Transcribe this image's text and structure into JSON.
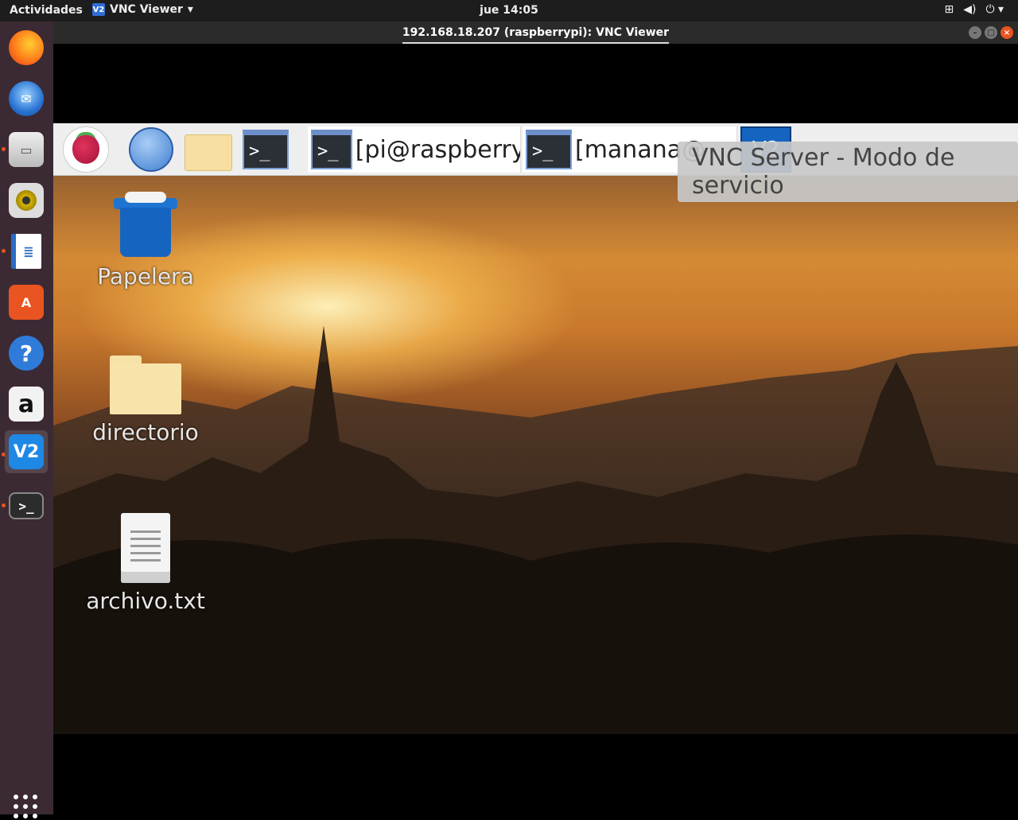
{
  "topbar": {
    "activities": "Actividades",
    "app_menu_label": "VNC Viewer",
    "clock": "jue 14:05",
    "icons": [
      "network-icon",
      "volume-icon",
      "power-icon",
      "chevron-down-icon"
    ]
  },
  "dock": {
    "items": [
      {
        "name": "Firefox",
        "icon": "firefox-icon"
      },
      {
        "name": "Thunderbird",
        "icon": "thunderbird-icon"
      },
      {
        "name": "Archivos",
        "icon": "files-icon"
      },
      {
        "name": "Rhythmbox",
        "icon": "rhythmbox-icon"
      },
      {
        "name": "LibreOffice Writer",
        "icon": "writer-icon"
      },
      {
        "name": "Ubuntu Software",
        "icon": "software-icon"
      },
      {
        "name": "Ayuda",
        "icon": "help-icon",
        "glyph": "?"
      },
      {
        "name": "Amazon",
        "icon": "amazon-icon",
        "glyph": "a"
      },
      {
        "name": "VNC Viewer",
        "icon": "vnc-icon",
        "glyph": "V2"
      },
      {
        "name": "Terminal",
        "icon": "terminal-icon",
        "glyph": ">_"
      }
    ],
    "accent": "#e95420"
  },
  "window": {
    "title": "192.168.18.207 (raspberrypi): VNC Viewer",
    "controls": [
      "minimize",
      "maximize",
      "close"
    ]
  },
  "remote": {
    "panel": {
      "terminal_glyph": ">_",
      "tasks": [
        {
          "label": "[pi@raspberry..."
        },
        {
          "label": "[manana@"
        }
      ],
      "vnc_glyph": "V2"
    },
    "tooltip": "VNC Server - Modo de servicio",
    "desktop_icons": [
      {
        "label": "Papelera",
        "icon": "trash-icon"
      },
      {
        "label": "directorio",
        "icon": "folder-icon"
      },
      {
        "label": "archivo.txt",
        "icon": "text-file-icon"
      }
    ]
  }
}
